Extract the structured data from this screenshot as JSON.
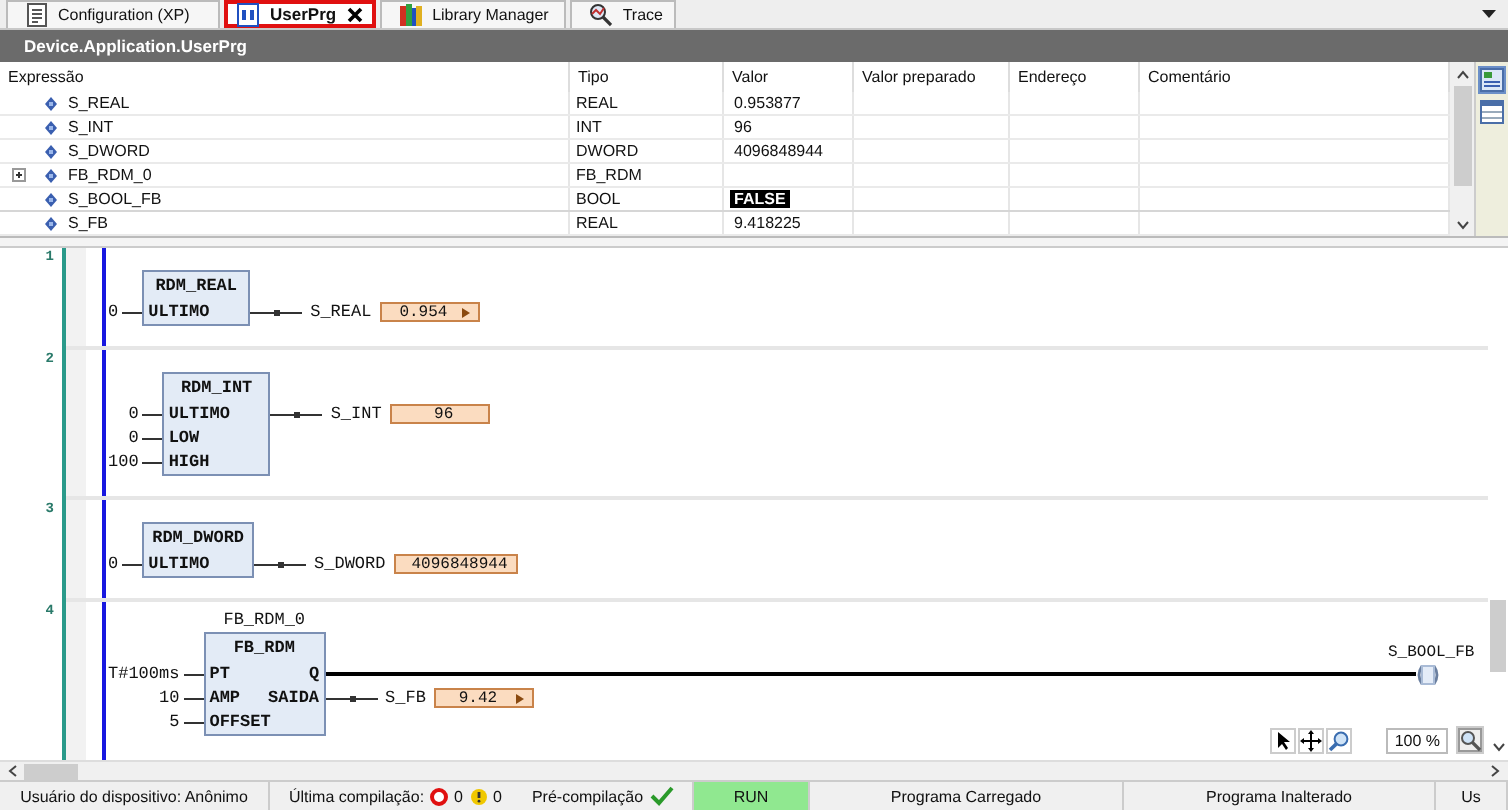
{
  "tabs": [
    {
      "label": "Configuration (XP)",
      "selected": false,
      "closable": false
    },
    {
      "label": "UserPrg",
      "selected": true,
      "closable": true
    },
    {
      "label": "Library Manager",
      "selected": false,
      "closable": false
    },
    {
      "label": "Trace",
      "selected": false,
      "closable": false
    }
  ],
  "editor_title": "Device.Application.UserPrg",
  "watch": {
    "columns": [
      "Expressão",
      "Tipo",
      "Valor",
      "Valor preparado",
      "Endereço",
      "Comentário"
    ],
    "rows": [
      {
        "expression": "S_REAL",
        "type": "REAL",
        "value": "0.953877",
        "expandable": false,
        "highlighted": false
      },
      {
        "expression": "S_INT",
        "type": "INT",
        "value": "96",
        "expandable": false,
        "highlighted": false
      },
      {
        "expression": "S_DWORD",
        "type": "DWORD",
        "value": "4096848944",
        "expandable": false,
        "highlighted": false
      },
      {
        "expression": "FB_RDM_0",
        "type": "FB_RDM",
        "expandable": true,
        "highlighted": false
      },
      {
        "expression": "S_BOOL_FB",
        "type": "BOOL",
        "value": "FALSE",
        "expandable": false,
        "highlighted": true
      },
      {
        "expression": "S_FB",
        "type": "REAL",
        "value": "9.418225",
        "expandable": false,
        "highlighted": false
      }
    ]
  },
  "networks": [
    {
      "number": "1",
      "block": {
        "name": "RDM_REAL",
        "inputs": [
          {
            "value": "0",
            "pin": "ULTIMO"
          }
        ],
        "outputs": [
          {
            "kind": "variable",
            "variable": "S_REAL",
            "value": "0.954",
            "has_menu": true
          }
        ]
      }
    },
    {
      "number": "2",
      "block": {
        "name": "RDM_INT",
        "inputs": [
          {
            "value": "0",
            "pin": "ULTIMO"
          },
          {
            "value": "0",
            "pin": "LOW"
          },
          {
            "value": "100",
            "pin": "HIGH"
          }
        ],
        "outputs": [
          {
            "kind": "variable",
            "variable": "S_INT",
            "value": "96",
            "has_menu": false
          }
        ]
      }
    },
    {
      "number": "3",
      "block": {
        "name": "RDM_DWORD",
        "inputs": [
          {
            "value": "0",
            "pin": "ULTIMO"
          }
        ],
        "outputs": [
          {
            "kind": "variable",
            "variable": "S_DWORD",
            "value": "4096848944",
            "has_menu": false
          }
        ]
      }
    },
    {
      "number": "4",
      "block": {
        "instance": "FB_RDM_0",
        "name": "FB_RDM",
        "inputs": [
          {
            "value": "T#100ms",
            "pin": "PT"
          },
          {
            "value": "10",
            "pin": "AMP"
          },
          {
            "value": "5",
            "pin": "OFFSET"
          }
        ],
        "outputs": [
          {
            "kind": "coil",
            "pin": "Q",
            "variable": "S_BOOL_FB"
          },
          {
            "kind": "variable",
            "pin": "SAIDA",
            "variable": "S_FB",
            "value": "9.42",
            "has_menu": true
          }
        ]
      }
    }
  ],
  "zoom": "100 %",
  "status": {
    "user": "Usuário do dispositivo: Anônimo",
    "compile_label": "Última compilação:",
    "errors": "0",
    "warnings": "0",
    "precompile_label": "Pré-compilação",
    "run_state": "RUN",
    "program_state": "Programa Carregado",
    "change_state": "Programa Inalterado",
    "extra": "Us"
  }
}
